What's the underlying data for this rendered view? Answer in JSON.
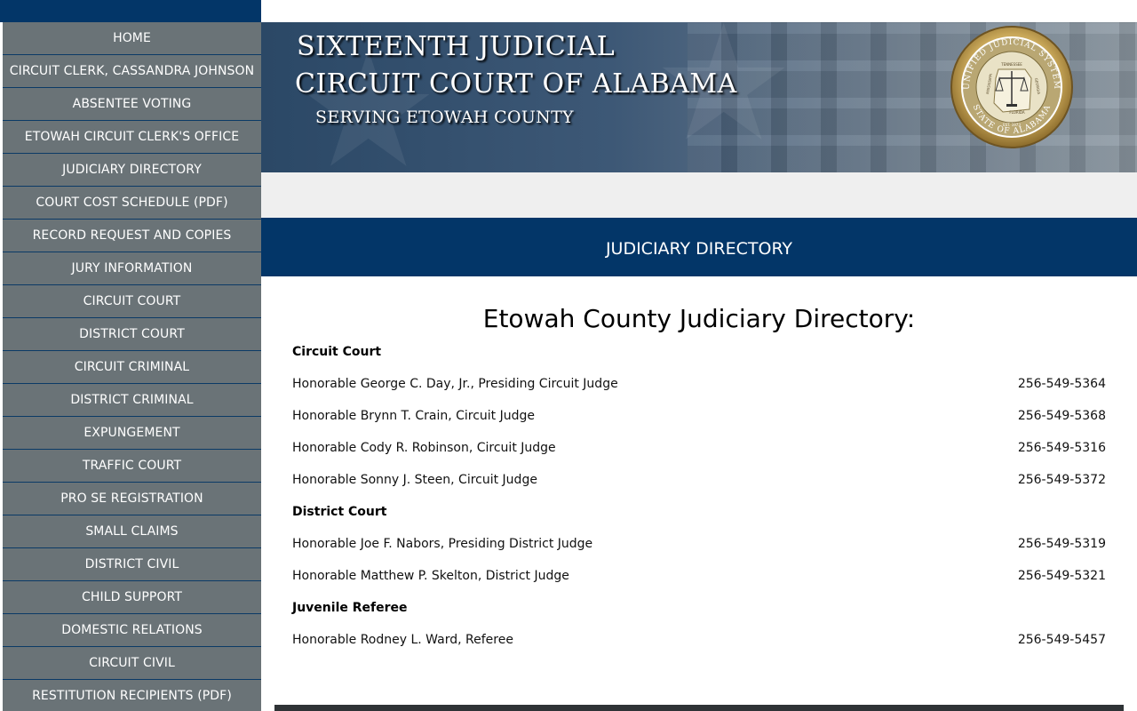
{
  "sidebar": {
    "items": [
      {
        "label": "HOME"
      },
      {
        "label": "CIRCUIT CLERK, CASSANDRA JOHNSON"
      },
      {
        "label": "ABSENTEE VOTING"
      },
      {
        "label": "ETOWAH CIRCUIT CLERK'S OFFICE"
      },
      {
        "label": "JUDICIARY DIRECTORY"
      },
      {
        "label": "COURT COST SCHEDULE (PDF)"
      },
      {
        "label": "RECORD REQUEST AND COPIES"
      },
      {
        "label": "JURY INFORMATION"
      },
      {
        "label": "CIRCUIT COURT"
      },
      {
        "label": "DISTRICT COURT"
      },
      {
        "label": "CIRCUIT CRIMINAL"
      },
      {
        "label": "DISTRICT CRIMINAL"
      },
      {
        "label": "EXPUNGEMENT"
      },
      {
        "label": "TRAFFIC COURT"
      },
      {
        "label": "PRO SE REGISTRATION"
      },
      {
        "label": "SMALL CLAIMS"
      },
      {
        "label": "DISTRICT CIVIL"
      },
      {
        "label": "CHILD SUPPORT"
      },
      {
        "label": "DOMESTIC RELATIONS"
      },
      {
        "label": "CIRCUIT CIVIL"
      },
      {
        "label": "RESTITUTION RECIPIENTS (PDF)"
      }
    ]
  },
  "banner": {
    "line1": "SIXTEENTH JUDICIAL",
    "line2": "CIRCUIT COURT OF ALABAMA",
    "line3": "SERVING ETOWAH COUNTY",
    "seal_icon": "unified-judicial-system-seal-icon",
    "seal": {
      "top_text": "UNIFIED JUDICIAL SYSTEM",
      "bottom_text": "STATE OF ALABAMA",
      "left_text": "MISSISSIPPI",
      "right_text": "GEORGIA",
      "center_top": "TENNESSEE",
      "center_bottom": "FLORIDA",
      "year": "EST. 1973"
    }
  },
  "page_header": {
    "title": "JUDICIARY DIRECTORY"
  },
  "content": {
    "heading": "Etowah County Judiciary Directory:",
    "sections": [
      {
        "title": "Circuit Court",
        "entries": [
          {
            "name": "Honorable George C. Day, Jr., Presiding Circuit Judge",
            "phone": "256-549-5364"
          },
          {
            "name": "Honorable Brynn T. Crain, Circuit Judge",
            "phone": "256-549-5368"
          },
          {
            "name": "Honorable Cody R. Robinson, Circuit Judge",
            "phone": "256-549-5316"
          },
          {
            "name": "Honorable Sonny J. Steen, Circuit Judge",
            "phone": "256-549-5372"
          }
        ]
      },
      {
        "title": "District Court",
        "entries": [
          {
            "name": "Honorable Joe F. Nabors, Presiding District Judge",
            "phone": "256-549-5319"
          },
          {
            "name": "Honorable Matthew P. Skelton, District Judge",
            "phone": "256-549-5321"
          }
        ]
      },
      {
        "title": "Juvenile Referee",
        "entries": [
          {
            "name": "Honorable Rodney L. Ward, Referee",
            "phone": "256-549-5457"
          }
        ]
      }
    ]
  },
  "colors": {
    "navy": "#033668",
    "sidebar_item": "#6a7377",
    "grey_band": "#efefef",
    "footer": "#2f3336"
  }
}
